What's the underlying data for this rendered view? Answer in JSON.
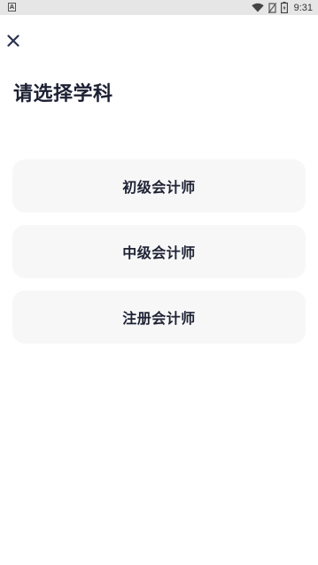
{
  "status_bar": {
    "left_icon": "app-notification-icon",
    "left_icon_glyph": "A",
    "icons": [
      "wifi-icon",
      "no-sim-icon",
      "battery-icon"
    ],
    "time": "9:31"
  },
  "header": {
    "close_icon": "close-icon",
    "title": "请选择学科"
  },
  "subjects": [
    {
      "label": "初级会计师"
    },
    {
      "label": "中级会计师"
    },
    {
      "label": "注册会计师"
    }
  ],
  "colors": {
    "status_bar_bg": "#e6e6e6",
    "card_bg": "#f7f7f8",
    "text_dark": "#1c2033",
    "close_icon": "#2b3150"
  }
}
